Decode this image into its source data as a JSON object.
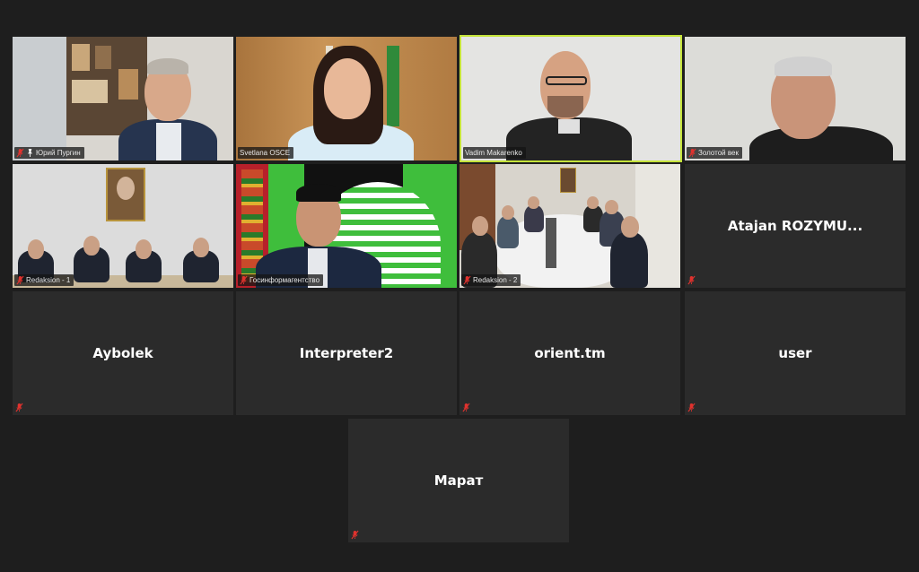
{
  "participants": [
    {
      "name": "Юрий Пургин",
      "has_video": true,
      "speaking": false,
      "muted": true
    },
    {
      "name": "Svetlana OSCE",
      "has_video": true,
      "speaking": false,
      "muted": false
    },
    {
      "name": "Vadim Makarenko",
      "has_video": true,
      "speaking": true,
      "muted": false
    },
    {
      "name": "Золотой век",
      "has_video": true,
      "speaking": false,
      "muted": true
    },
    {
      "name": "Redaksion - 1",
      "has_video": true,
      "speaking": false,
      "muted": true
    },
    {
      "name": "Госинформагентство",
      "has_video": true,
      "speaking": false,
      "muted": true
    },
    {
      "name": "Redaksion - 2",
      "has_video": true,
      "speaking": false,
      "muted": true
    },
    {
      "name": "Atajan  ROZYMU...",
      "has_video": false,
      "speaking": false,
      "muted": true
    },
    {
      "name": "Aybolek",
      "has_video": false,
      "speaking": false,
      "muted": true
    },
    {
      "name": "Interpreter2",
      "has_video": false,
      "speaking": false,
      "muted": false
    },
    {
      "name": "orient.tm",
      "has_video": false,
      "speaking": false,
      "muted": true
    },
    {
      "name": "user",
      "has_video": false,
      "speaking": false,
      "muted": true
    },
    {
      "name": "Марат",
      "has_video": false,
      "speaking": false,
      "muted": true
    }
  ],
  "colors": {
    "background": "#1e1e1e",
    "tile": "#2b2b2b",
    "active_speaker_border": "#c5e33a",
    "muted_icon": "#e0322e"
  },
  "icons": {
    "muted": "mic-muted-icon",
    "unmuted": "mic-icon"
  }
}
